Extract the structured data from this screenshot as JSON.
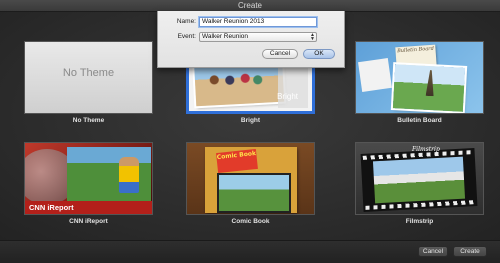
{
  "window": {
    "title": "Create"
  },
  "dialog": {
    "name_label": "Name:",
    "name_value": "Walker Reunion 2013",
    "event_label": "Event:",
    "event_value": "Walker Reunion",
    "cancel_label": "Cancel",
    "ok_label": "OK"
  },
  "themes": [
    {
      "caption": "No Theme",
      "tile_text": "No Theme",
      "selected": false
    },
    {
      "caption": "Bright",
      "tile_text": "Bright",
      "selected": true
    },
    {
      "caption": "Bulletin Board",
      "tile_text": "Bulletin Board",
      "selected": false
    },
    {
      "caption": "CNN iReport",
      "tile_text": "CNN iReport",
      "selected": false
    },
    {
      "caption": "Comic Book",
      "tile_text": "Comic Book",
      "selected": false
    },
    {
      "caption": "Filmstrip",
      "tile_text": "Filmstrip",
      "selected": false
    }
  ],
  "footer": {
    "cancel_label": "Cancel",
    "create_label": "Create"
  },
  "colors": {
    "selection": "#2f6fd8",
    "background": "#2c2c2c"
  }
}
